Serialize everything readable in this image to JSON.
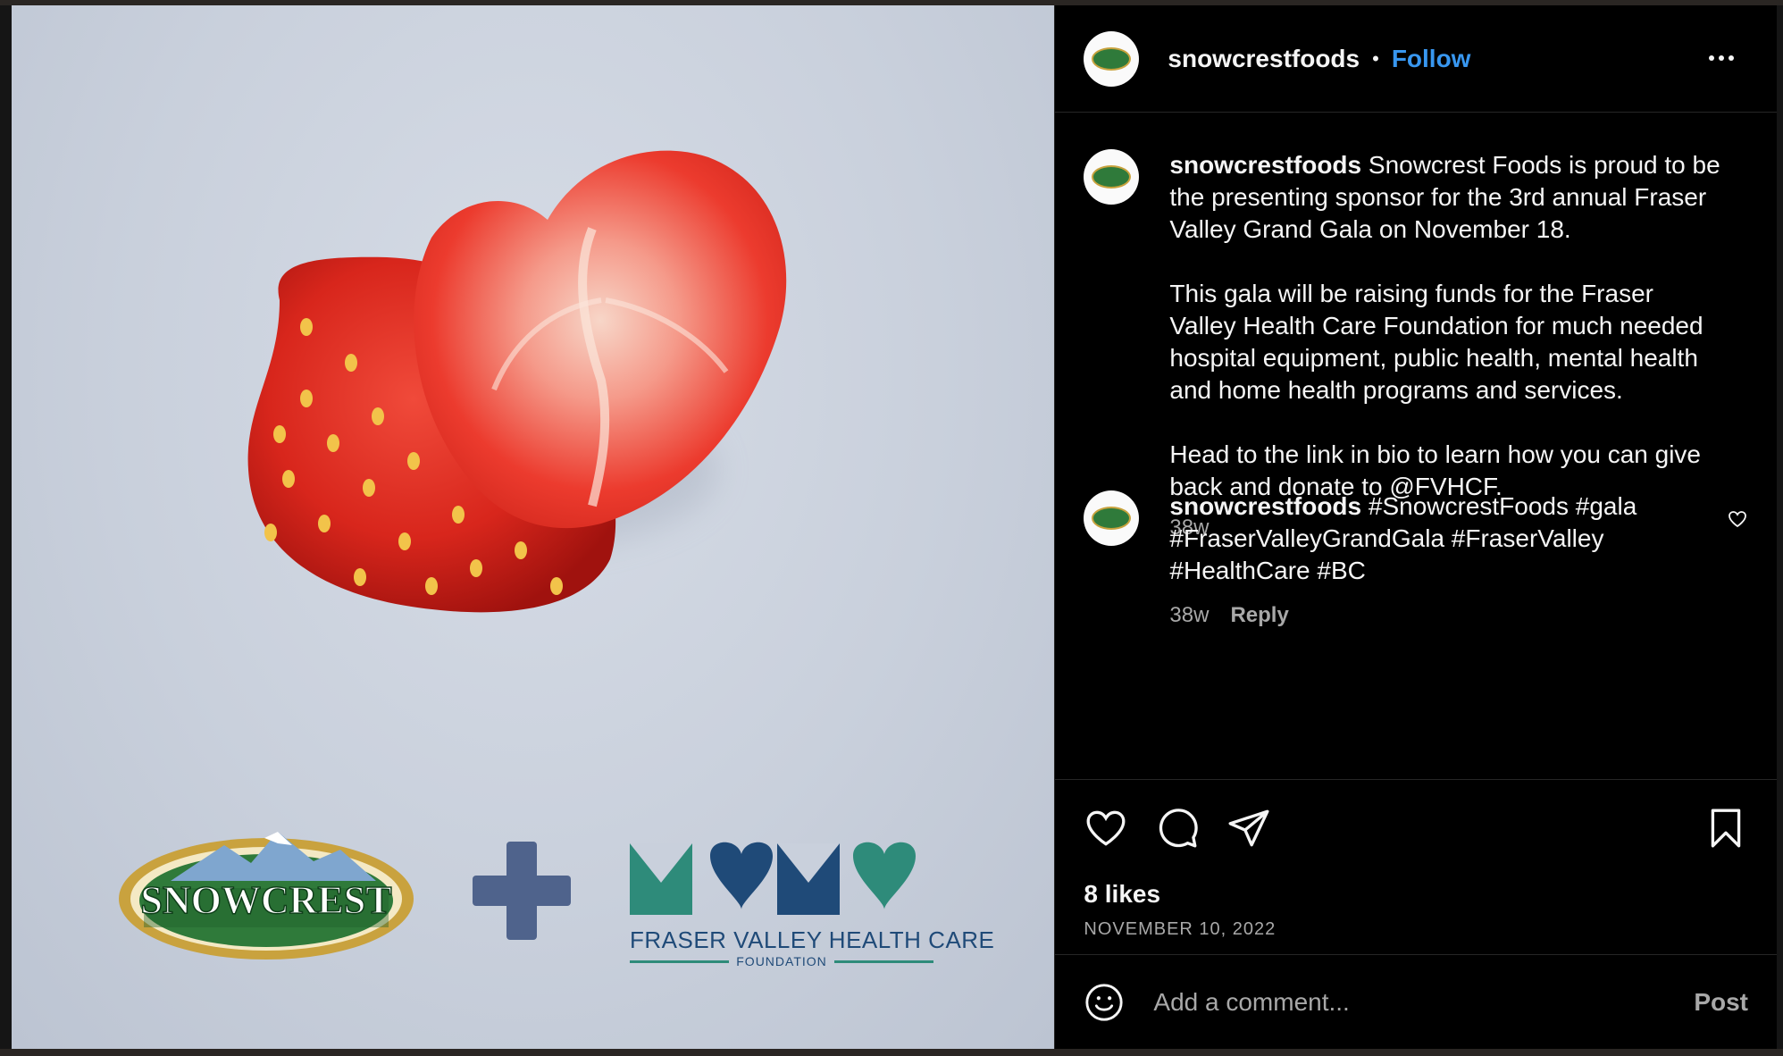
{
  "post": {
    "username": "snowcrestfoods",
    "separator": "•",
    "follow_label": "Follow",
    "more_label": "More options"
  },
  "media": {
    "brand_logo_text": "SNOWCREST",
    "partner_logo_text": "FRASER VALLEY HEALTH CARE",
    "partner_logo_subtext": "FOUNDATION"
  },
  "caption": {
    "username": "snowcrestfoods",
    "paragraphs": [
      "Snowcrest Foods is proud to be the presenting sponsor for the 3rd annual Fraser Valley Grand Gala on November 18.",
      "This gala will be raising funds for the Fraser Valley Health Care Foundation for much needed hospital equipment, public health, mental health and home health programs and services.",
      "Head to the link in bio to learn how you can give back and donate to @FVHCF."
    ],
    "time": "38w"
  },
  "comment": {
    "username": "snowcrestfoods",
    "text": "#SnowcrestFoods #gala #FraserValleyGrandGala #FraserValley #HealthCare #BC",
    "time": "38w",
    "reply_label": "Reply"
  },
  "stats": {
    "likes": "8 likes",
    "date": "NOVEMBER 10, 2022"
  },
  "composer": {
    "placeholder": "Add a comment...",
    "post_label": "Post"
  },
  "colors": {
    "accent": "#3897f0",
    "background": "#000000",
    "muted": "#a8a8a8"
  },
  "icons": [
    "more-icon",
    "heart-icon",
    "comment-icon",
    "share-icon",
    "bookmark-icon",
    "emoji-icon"
  ]
}
